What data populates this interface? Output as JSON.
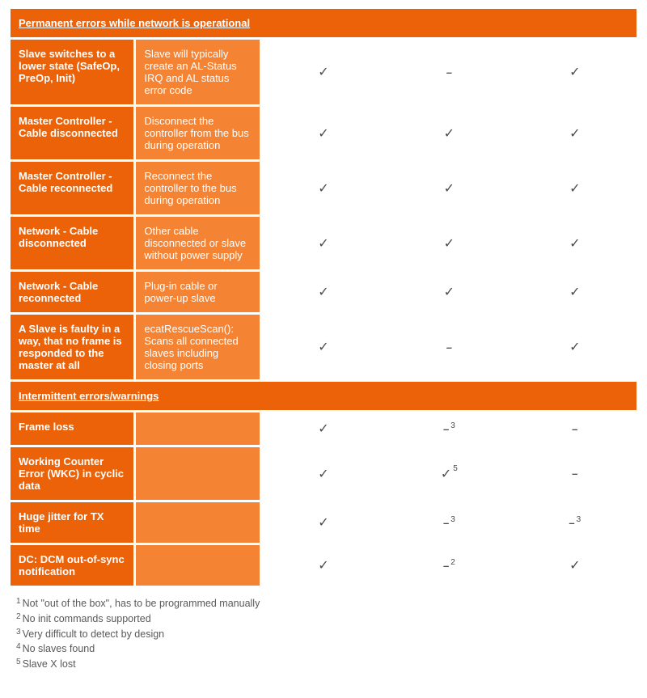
{
  "marks": {
    "check": "✓",
    "dash": "–"
  },
  "sections": [
    {
      "title": "Permanent errors while network is operational",
      "rows": [
        {
          "label": "Slave switches to a lower state (SafeOp, PreOp, Init)",
          "desc": "Slave will typically create an AL-Status IRQ and AL status error code",
          "c3": {
            "type": "check"
          },
          "c4": {
            "type": "dash"
          },
          "c5": {
            "type": "check"
          }
        },
        {
          "label": "Master Controller - Cable disconnected",
          "desc": "Disconnect the controller from the bus during operation",
          "c3": {
            "type": "check"
          },
          "c4": {
            "type": "check"
          },
          "c5": {
            "type": "check"
          }
        },
        {
          "label": "Master Controller - Cable reconnected",
          "desc": "Reconnect the controller to the bus during operation",
          "c3": {
            "type": "check"
          },
          "c4": {
            "type": "check"
          },
          "c5": {
            "type": "check"
          }
        },
        {
          "label": "Network - Cable disconnected",
          "desc": "Other cable disconnected or slave without power supply",
          "c3": {
            "type": "check"
          },
          "c4": {
            "type": "check"
          },
          "c5": {
            "type": "check"
          }
        },
        {
          "label": "Network - Cable reconnected",
          "desc": "Plug-in cable or power-up slave",
          "c3": {
            "type": "check"
          },
          "c4": {
            "type": "check"
          },
          "c5": {
            "type": "check"
          }
        },
        {
          "label": "A Slave is faulty in a way, that no frame is responded to the master at all",
          "desc": "ecatRescueScan(): Scans all connected slaves including closing ports",
          "c3": {
            "type": "check"
          },
          "c4": {
            "type": "dash"
          },
          "c5": {
            "type": "check"
          }
        }
      ]
    },
    {
      "title": "Intermittent errors/warnings",
      "rows": [
        {
          "label": "Frame loss",
          "desc": "",
          "c3": {
            "type": "check"
          },
          "c4": {
            "type": "dash",
            "sup": "3"
          },
          "c5": {
            "type": "dash"
          }
        },
        {
          "label": "Working Counter Error (WKC) in cyclic data",
          "desc": "",
          "c3": {
            "type": "check"
          },
          "c4": {
            "type": "check",
            "sup": "5"
          },
          "c5": {
            "type": "dash"
          }
        },
        {
          "label": "Huge jitter for TX time",
          "desc": "",
          "c3": {
            "type": "check"
          },
          "c4": {
            "type": "dash",
            "sup": "3"
          },
          "c5": {
            "type": "dash",
            "sup": "3"
          }
        },
        {
          "label": "DC: DCM out-of-sync notification",
          "desc": "",
          "c3": {
            "type": "check"
          },
          "c4": {
            "type": "dash",
            "sup": "2"
          },
          "c5": {
            "type": "check"
          }
        }
      ]
    }
  ],
  "footnotes": [
    {
      "n": "1",
      "t": "Not \"out of the box\", has to be programmed manually"
    },
    {
      "n": "2",
      "t": "No init commands supported"
    },
    {
      "n": "3",
      "t": "Very difficult to detect by design"
    },
    {
      "n": "4",
      "t": "No slaves found"
    },
    {
      "n": "5",
      "t": "Slave X lost"
    }
  ]
}
